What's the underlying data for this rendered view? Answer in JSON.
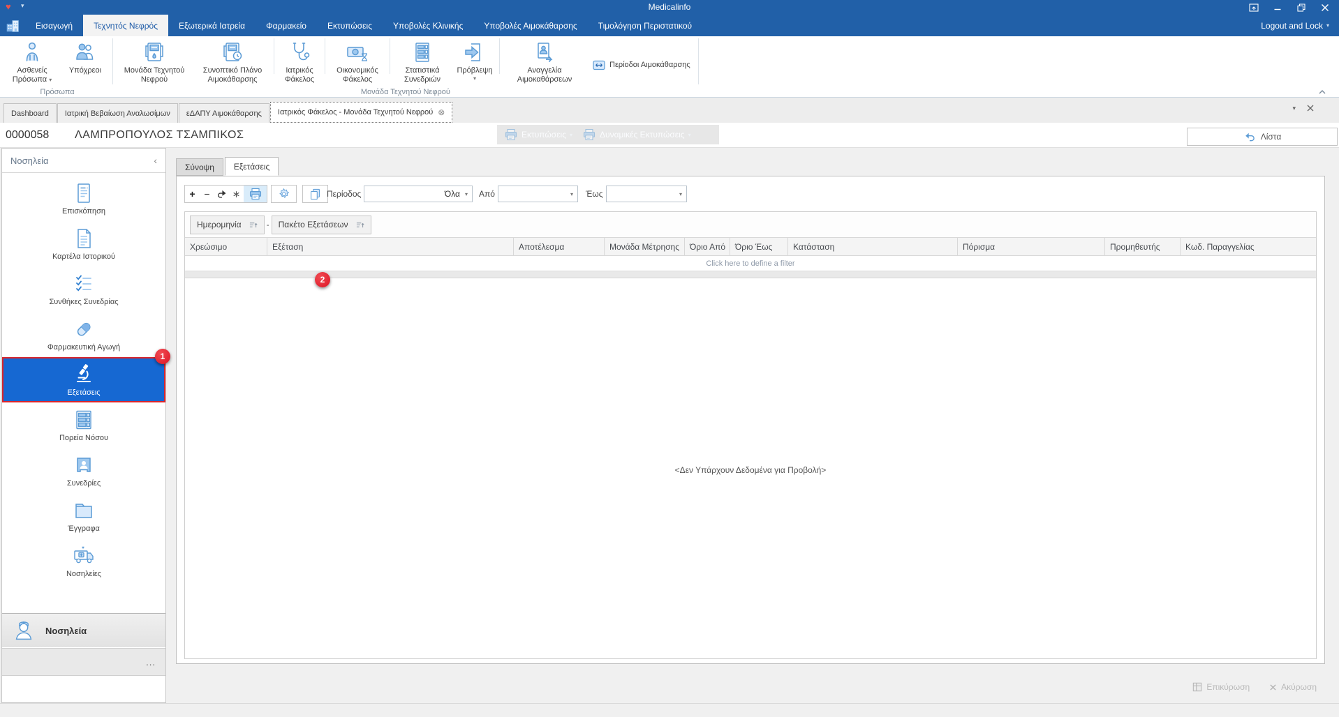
{
  "titlebar": {
    "title": "Medicalinfo",
    "logout_label": "Logout and Lock"
  },
  "menu": {
    "tabs": [
      "Εισαγωγή",
      "Τεχνητός Νεφρός",
      "Εξωτερικά Ιατρεία",
      "Φαρμακείο",
      "Εκτυπώσεις",
      "Υποβολές Κλινικής",
      "Υποβολές Αιμοκάθαρσης",
      "Τιμολόγηση Περιστατικού"
    ]
  },
  "ribbon": {
    "groups": [
      {
        "label": "Πρόσωπα"
      },
      {
        "label": "Μονάδα Τεχνητού Νεφρού"
      }
    ],
    "buttons": {
      "patients": {
        "label": "Ασθενείς Πρόσωπα",
        "icon": "patient"
      },
      "obligors": {
        "label": "Υπόχρεοι",
        "icon": "people"
      },
      "unit": {
        "label": "Μονάδα Τεχνητού Νεφρού",
        "icon": "dialysis-machine"
      },
      "plan": {
        "label": "Συνοπτικό Πλάνο Αιμοκάθαρσης",
        "icon": "dialysis-plan"
      },
      "medical_file": {
        "label": "Ιατρικός Φάκελος",
        "icon": "stethoscope"
      },
      "financial_file": {
        "label": "Οικονομικός Φάκελος",
        "icon": "finance"
      },
      "session_stats": {
        "label": "Στατιστικά Συνεδριών",
        "icon": "stats"
      },
      "forecast": {
        "label": "Πρόβλεψη",
        "icon": "forecast"
      },
      "announcement": {
        "label": "Αναγγελία Αιμοκαθάρσεων",
        "icon": "announce"
      },
      "periods": {
        "label": "Περίοδοι Αιμοκάθαρσης",
        "icon": "swap"
      }
    }
  },
  "doc_tabs": {
    "items": [
      "Dashboard",
      "Ιατρική Βεβαίωση Αναλωσίμων",
      "εΔΑΠΥ Αιμοκάθαρσης",
      "Ιατρικός Φάκελος - Μονάδα Τεχνητού Νεφρού"
    ]
  },
  "patient": {
    "code": "0000058",
    "name": "ΛΑΜΠΡΟΠΟΥΛΟΣ ΤΣΑΜΠΙΚΟΣ"
  },
  "header_actions": {
    "prints": "Εκτυπώσεις",
    "dynamic_prints": "Δυναμικές Εκτυπώσεις",
    "list": "Λίστα"
  },
  "sidebar": {
    "title": "Νοσηλεία",
    "items": [
      {
        "label": "Επισκόπηση",
        "icon": "doc-lines"
      },
      {
        "label": "Καρτέλα Ιστορικού",
        "icon": "doc-history"
      },
      {
        "label": "Συνθήκες Συνεδρίας",
        "icon": "checklist"
      },
      {
        "label": "Φαρμακευτική Αγωγή",
        "icon": "capsule"
      },
      {
        "label": "Εξετάσεις",
        "icon": "microscope",
        "selected": true,
        "badge": "1"
      },
      {
        "label": "Πορεία Νόσου",
        "icon": "grid-rows"
      },
      {
        "label": "Συνεδρίες",
        "icon": "person-card"
      },
      {
        "label": "Έγγραφα",
        "icon": "folder"
      },
      {
        "label": "Νοσηλείες",
        "icon": "ambulance"
      }
    ],
    "footer": {
      "label": "Νοσηλεία",
      "icon": "nurse",
      "overflow": "..."
    }
  },
  "main": {
    "tabs": [
      "Σύνοψη",
      "Εξετάσεις"
    ],
    "toolbar": {
      "period_label": "Περίοδος",
      "period_value": "Όλα",
      "from_label": "Από",
      "to_label": "Έως"
    },
    "group_by": [
      "Ημερομηνία",
      "Πακέτο Εξετάσεων"
    ],
    "table": {
      "columns": [
        "Χρεώσιμο",
        "Εξέταση",
        "Αποτέλεσμα",
        "Μονάδα Μέτρησης",
        "Όριο Από",
        "Όριο Έως",
        "Κατάσταση",
        "Πόρισμα",
        "Προμηθευτής",
        "Κωδ. Παραγγελίας"
      ],
      "filter_hint": "Click here to define a filter",
      "empty_message": "<Δεν Υπάρχουν Δεδομένα για Προβολή>"
    }
  },
  "footer": {
    "confirm": "Επικύρωση",
    "cancel": "Ακύρωση"
  },
  "badges": {
    "step1": "1",
    "step2": "2"
  },
  "colors": {
    "titlebar": "#2160A8",
    "selection": "#1668D2",
    "badge": "#DD1424",
    "icon_blue": "#5B9BD5"
  }
}
